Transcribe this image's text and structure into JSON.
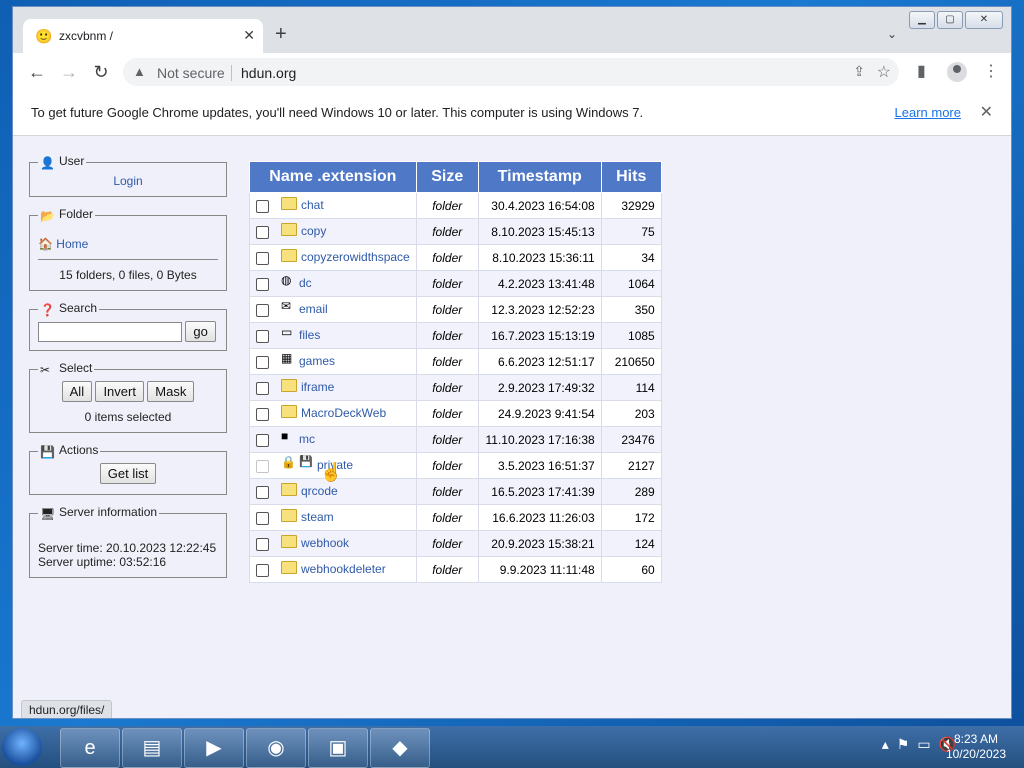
{
  "browser": {
    "tab_title": "zxcvbnm /",
    "tab_favicon": "smiley-icon",
    "security_label": "Not secure",
    "url": "hdun.org",
    "infobar_message": "To get future Google Chrome updates, you'll need Windows 10 or later. This computer is using Windows 7.",
    "infobar_link": "Learn more",
    "status_url": "hdun.org/files/"
  },
  "sidebar": {
    "user": {
      "legend": "User",
      "login": "Login"
    },
    "folder": {
      "legend": "Folder",
      "home": "Home",
      "summary": "15 folders, 0 files, 0 Bytes"
    },
    "search": {
      "legend": "Search",
      "value": "",
      "go": "go"
    },
    "select": {
      "legend": "Select",
      "all": "All",
      "invert": "Invert",
      "mask": "Mask",
      "count": "0 items selected"
    },
    "actions": {
      "legend": "Actions",
      "get_list": "Get list"
    },
    "server": {
      "legend": "Server information",
      "time": "Server time: 20.10.2023 12:22:45",
      "uptime": "Server uptime: 03:52:16"
    }
  },
  "table": {
    "headers": [
      "Name .extension",
      "Size",
      "Timestamp",
      "Hits"
    ],
    "rows": [
      {
        "name": "chat",
        "size": "folder",
        "timestamp": "30.4.2023 16:54:08",
        "hits": "32929",
        "icon": "folder-icon"
      },
      {
        "name": "copy",
        "size": "folder",
        "timestamp": "8.10.2023 15:45:13",
        "hits": "75",
        "icon": "folder-icon"
      },
      {
        "name": "copyzerowidthspace",
        "size": "folder",
        "timestamp": "8.10.2023 15:36:11",
        "hits": "34",
        "icon": "folder-icon"
      },
      {
        "name": "dc",
        "size": "folder",
        "timestamp": "4.2.2023 13:41:48",
        "hits": "1064",
        "icon": "discord-icon"
      },
      {
        "name": "email",
        "size": "folder",
        "timestamp": "12.3.2023 12:52:23",
        "hits": "350",
        "icon": "email-icon"
      },
      {
        "name": "files",
        "size": "folder",
        "timestamp": "16.7.2023 15:13:19",
        "hits": "1085",
        "icon": "files-icon"
      },
      {
        "name": "games",
        "size": "folder",
        "timestamp": "6.6.2023 12:51:17",
        "hits": "210650",
        "icon": "games-icon"
      },
      {
        "name": "iframe",
        "size": "folder",
        "timestamp": "2.9.2023 17:49:32",
        "hits": "114",
        "icon": "folder-icon"
      },
      {
        "name": "MacroDeckWeb",
        "size": "folder",
        "timestamp": "24.9.2023 9:41:54",
        "hits": "203",
        "icon": "folder-icon"
      },
      {
        "name": "mc",
        "size": "folder",
        "timestamp": "11.10.2023 17:16:38",
        "hits": "23476",
        "icon": "minecraft-icon"
      },
      {
        "name": "private",
        "size": "folder",
        "timestamp": "3.5.2023 16:51:37",
        "hits": "2127",
        "icon": "lock-icon"
      },
      {
        "name": "qrcode",
        "size": "folder",
        "timestamp": "16.5.2023 17:41:39",
        "hits": "289",
        "icon": "folder-icon"
      },
      {
        "name": "steam",
        "size": "folder",
        "timestamp": "16.6.2023 11:26:03",
        "hits": "172",
        "icon": "folder-icon"
      },
      {
        "name": "webhook",
        "size": "folder",
        "timestamp": "20.9.2023 15:38:21",
        "hits": "124",
        "icon": "folder-icon"
      },
      {
        "name": "webhookdeleter",
        "size": "folder",
        "timestamp": "9.9.2023 11:11:48",
        "hits": "60",
        "icon": "folder-icon"
      }
    ]
  },
  "taskbar": {
    "time": "8:23 AM",
    "date": "10/20/2023"
  }
}
